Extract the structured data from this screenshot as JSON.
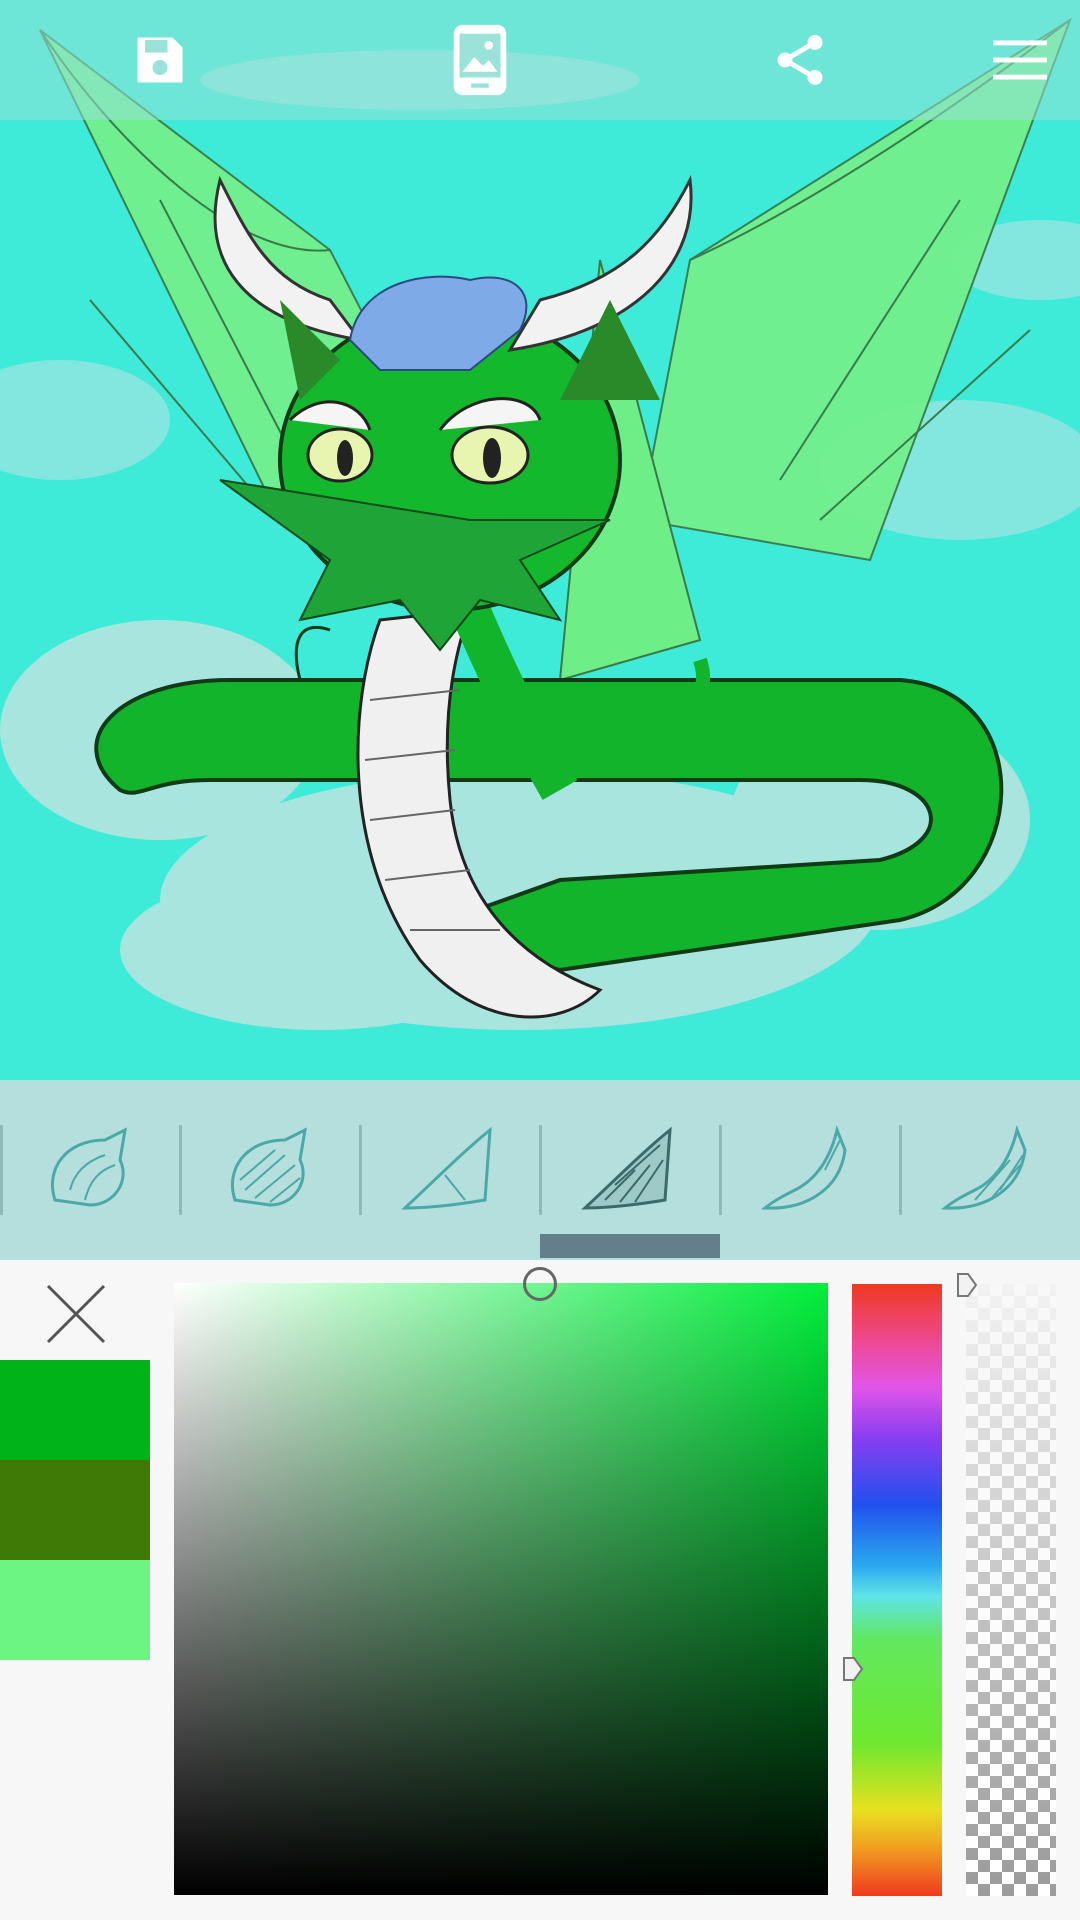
{
  "toolbar": {
    "buttons": [
      {
        "icon": "save-icon"
      },
      {
        "icon": "wallpaper-phone-icon"
      },
      {
        "icon": "share-icon"
      },
      {
        "icon": "menu-icon"
      }
    ]
  },
  "canvas": {
    "background_color": "#3eead8",
    "subject": "green-dragon-artwork"
  },
  "part_strip": {
    "items": [
      {
        "icon": "fur-tuft-outline-icon"
      },
      {
        "icon": "fur-tuft-shaded-icon"
      },
      {
        "icon": "wing-fin-outline-icon"
      },
      {
        "icon": "wing-fin-shaded-icon"
      },
      {
        "icon": "tail-tip-outline-icon"
      },
      {
        "icon": "tail-tip-shaded-icon"
      }
    ]
  },
  "color_picker": {
    "recent_colors": [
      "#00b318",
      "#3f7a06",
      "#6df583"
    ],
    "selected_hue_color": "#00ee3a",
    "close_icon": "close-icon"
  }
}
